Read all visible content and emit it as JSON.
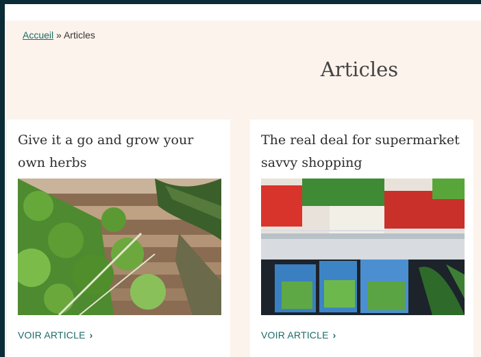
{
  "breadcrumb": {
    "home": "Accueil",
    "separator": "»",
    "current": "Articles"
  },
  "page": {
    "title": "Articles"
  },
  "articles": [
    {
      "title": "Give it a go and grow your own herbs",
      "link": "VOIR ARTICLE",
      "image": "herbs-photo"
    },
    {
      "title": "The real deal for supermarket savvy shopping",
      "link": "VOIR ARTICLE",
      "image": "supermarket-shelf-photo"
    }
  ],
  "icons": {
    "link_arrow": "chevron-right-icon"
  },
  "colors": {
    "accent": "#1a6a66",
    "page_bg": "#fbf3ec",
    "frame": "#0b2b36"
  }
}
